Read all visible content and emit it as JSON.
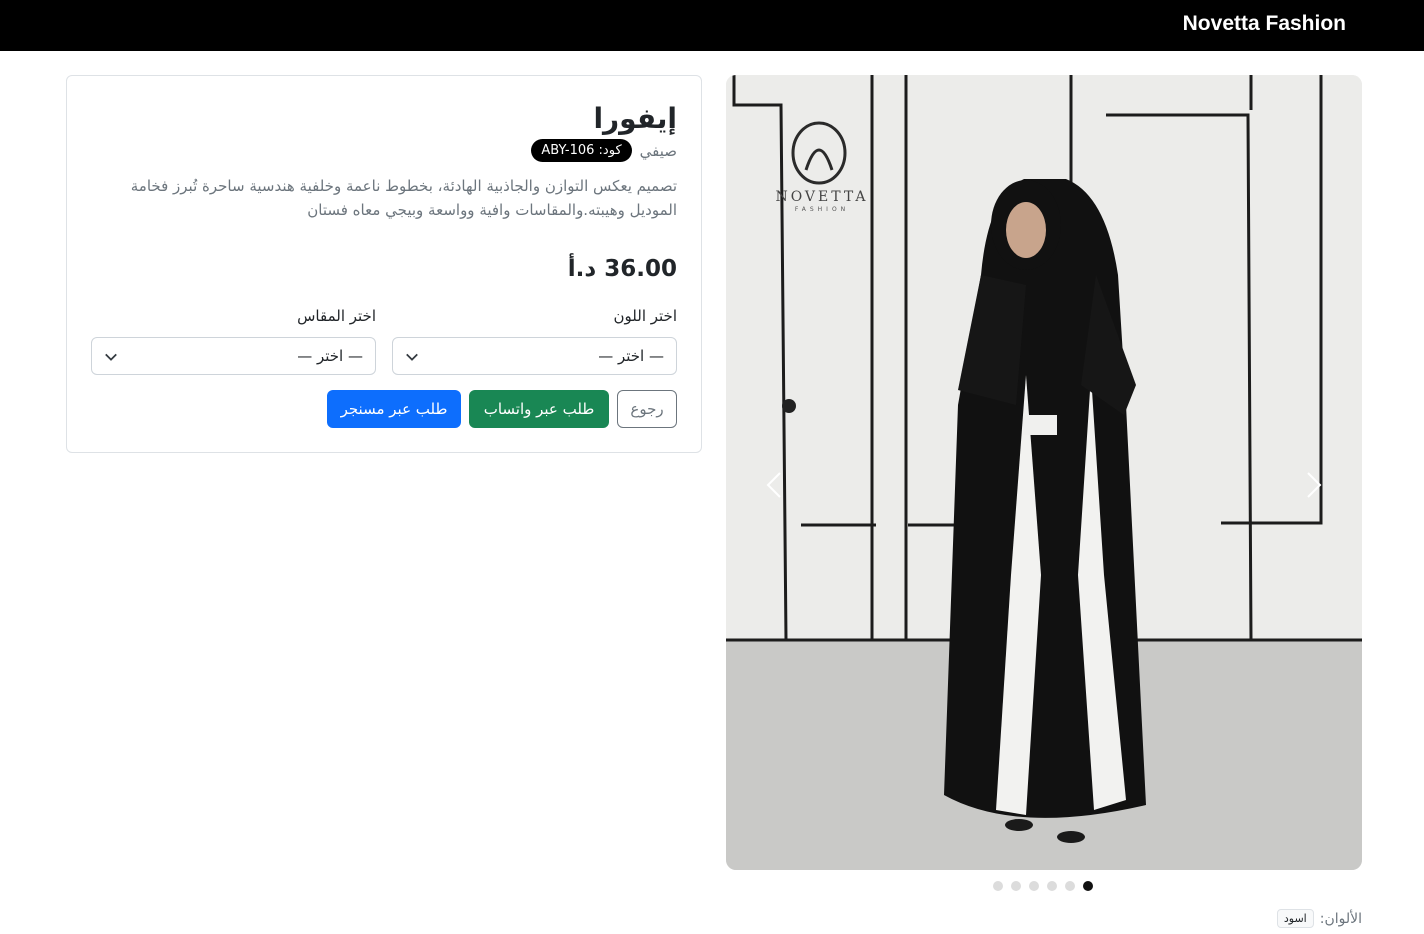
{
  "brand": "Novetta Fashion",
  "product": {
    "name": "إيفورا",
    "category": "صيفي",
    "code_label": "كود: ABY-106",
    "description": "تصميم يعكس التوازن والجاذبية الهادئة، بخطوط ناعمة وخلفية هندسية ساحرة تُبرز فخامة الموديل وهيبته.والمقاسات وافية وواسعة وبيجي معاه فستان",
    "price": "36.00 د.أ"
  },
  "form": {
    "color_label": "اختر اللون",
    "size_label": "اختر المقاس",
    "color_value": "— اختر —",
    "size_value": "— اختر —"
  },
  "buttons": {
    "back": "رجوع",
    "whatsapp": "طلب عبر واتساب",
    "messenger": "طلب عبر مسنجر"
  },
  "carousel": {
    "image_logo_text": "NOVETTA",
    "image_logo_subtext": "FASHION",
    "slide_count": 6,
    "active_index": 5
  },
  "colors": {
    "label": "الألوان:",
    "items": [
      "اسود"
    ]
  },
  "theme": {
    "navbar": "#000000",
    "whatsapp_green": "#198754",
    "messenger_blue": "#0d6efd",
    "badge_black": "#000000"
  }
}
